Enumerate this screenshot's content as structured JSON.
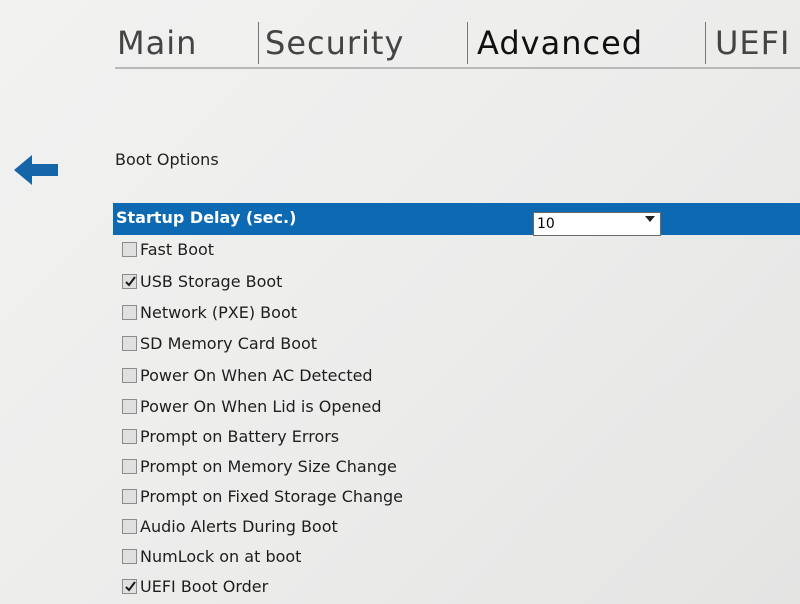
{
  "tabs": [
    {
      "label": "Main",
      "active": false
    },
    {
      "label": "Security",
      "active": false
    },
    {
      "label": "Advanced",
      "active": true
    },
    {
      "label": "UEFI",
      "active": false
    }
  ],
  "back_icon": "arrow-left-icon",
  "section_title": "Boot Options",
  "startup_delay": {
    "label": "Startup Delay (sec.)",
    "value": "10",
    "highlight_color": "#0d6ab2"
  },
  "options": [
    {
      "label": "Fast Boot",
      "checked": false
    },
    {
      "label": "USB Storage Boot",
      "checked": true
    },
    {
      "label": "Network (PXE) Boot",
      "checked": false
    },
    {
      "label": "SD Memory Card Boot",
      "checked": false
    },
    {
      "label": "Power On When AC Detected",
      "checked": false
    },
    {
      "label": "Power On When Lid is Opened",
      "checked": false
    },
    {
      "label": "Prompt on Battery Errors",
      "checked": false
    },
    {
      "label": "Prompt on Memory Size Change",
      "checked": false
    },
    {
      "label": "Prompt on Fixed Storage Change",
      "checked": false
    },
    {
      "label": "Audio Alerts During Boot",
      "checked": false
    },
    {
      "label": "NumLock on at boot",
      "checked": false
    },
    {
      "label": "UEFI Boot Order",
      "checked": true
    }
  ]
}
